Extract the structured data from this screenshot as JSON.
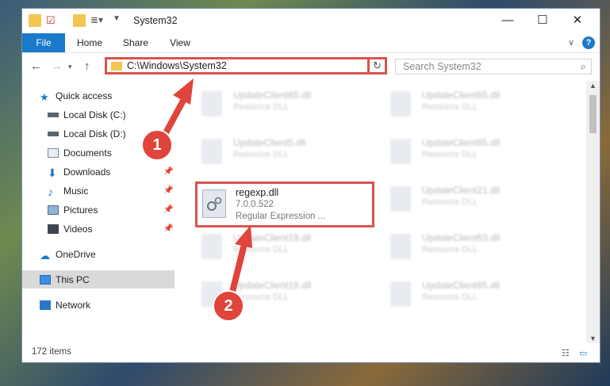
{
  "window": {
    "title": "System32",
    "controls": {
      "minimize": "—",
      "maximize": "☐",
      "close": "✕"
    }
  },
  "ribbon": {
    "tabs": [
      "File",
      "Home",
      "Share",
      "View"
    ],
    "help": "?"
  },
  "address": {
    "path": "C:\\Windows\\System32",
    "search_placeholder": "Search System32"
  },
  "sidebar": {
    "quick_access": "Quick access",
    "items": [
      {
        "label": "Local Disk (C:)",
        "icon": "drive-icon",
        "pinned": false
      },
      {
        "label": "Local Disk (D:)",
        "icon": "drive-icon",
        "pinned": false
      },
      {
        "label": "Documents",
        "icon": "documents-icon",
        "pinned": false
      },
      {
        "label": "Downloads",
        "icon": "downloads-icon",
        "pinned": true
      },
      {
        "label": "Music",
        "icon": "music-icon",
        "pinned": true
      },
      {
        "label": "Pictures",
        "icon": "pictures-icon",
        "pinned": true
      },
      {
        "label": "Videos",
        "icon": "videos-icon",
        "pinned": true
      }
    ],
    "onedrive": "OneDrive",
    "this_pc": "This PC",
    "network": "Network"
  },
  "files": {
    "left_column": [
      {
        "name": "UpdateClient65.dll",
        "type": "Resource DLL"
      },
      {
        "name": "UpdateClient5.dll",
        "type": "Resource DLL"
      },
      {
        "name": "UpdateClient19.dll",
        "type": "Resource DLL"
      },
      {
        "name": "UpdateClient19.dll",
        "type": "Resource DLL"
      }
    ],
    "right_column": [
      {
        "name": "UpdateClient65.dll",
        "type": "Resource DLL"
      },
      {
        "name": "UpdateClient65.dll",
        "type": "Resource DLL"
      },
      {
        "name": "UpdateClient21.dll",
        "type": "Resource DLL"
      },
      {
        "name": "UpdateClient63.dll",
        "type": "Resource DLL"
      },
      {
        "name": "UpdateClient65.dll",
        "type": "Resource DLL"
      }
    ],
    "highlighted": {
      "name": "regexp.dll",
      "version": "7.0.0.522",
      "type": "Regular Expression ..."
    }
  },
  "status": {
    "item_count": "172 items"
  },
  "annotations": {
    "step1": "1",
    "step2": "2"
  },
  "colors": {
    "accent": "#1979ca",
    "highlight": "#d9534f",
    "badge": "#e0443a"
  }
}
